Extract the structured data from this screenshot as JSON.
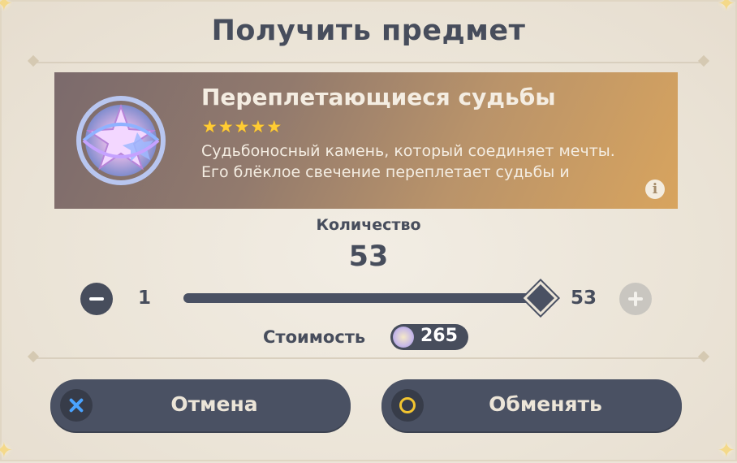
{
  "dialog": {
    "title": "Получить предмет"
  },
  "item": {
    "name": "Переплетающиеся судьбы",
    "rarity_stars": 5,
    "description": "Судьбоносный камень, который соединяет мечты. Его блёклое свечение переплетает судьбы и",
    "icon": "intertwined-fate-icon",
    "info_icon": "info-icon",
    "info_glyph": "i"
  },
  "quantity": {
    "label": "Количество",
    "value": "53",
    "min": "1",
    "max": "53",
    "fill_fraction": 1.0
  },
  "cost": {
    "label": "Стоимость",
    "value": "265",
    "currency_icon": "starglitter-icon"
  },
  "buttons": {
    "cancel_label": "Отмена",
    "confirm_label": "Обменять",
    "cancel_icon": "cross-button-icon",
    "confirm_icon": "circle-button-icon"
  },
  "colors": {
    "text_dark": "#474d5c",
    "button_bg": "#4a5163",
    "star_gold": "#ffcc33",
    "cancel_glyph": "#4aa3ff",
    "confirm_glyph": "#f3c530"
  }
}
